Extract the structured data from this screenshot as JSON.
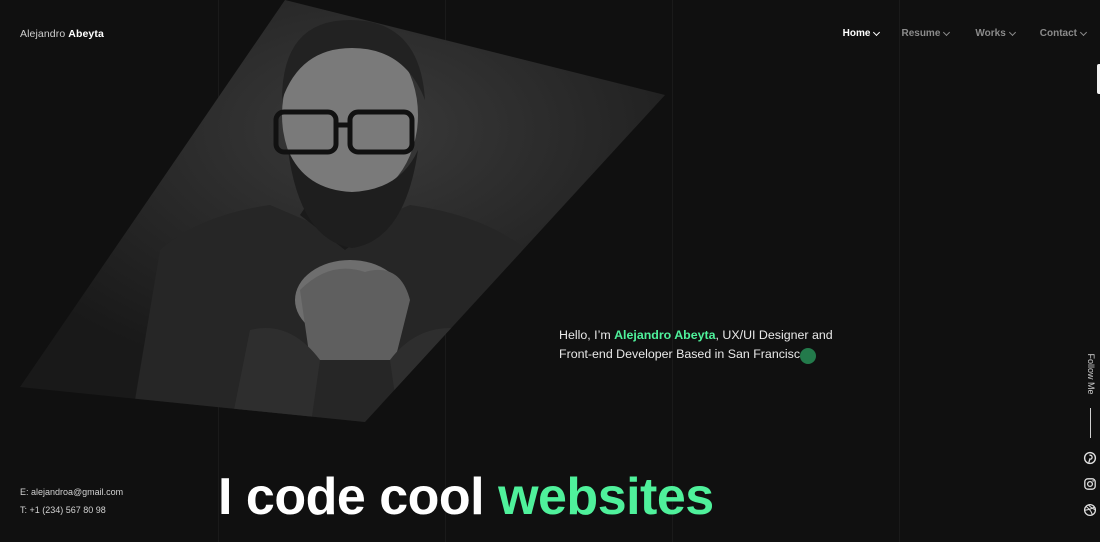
{
  "brand": {
    "first_name": "Alejandro",
    "last_name": "Abeyta"
  },
  "nav": {
    "items": [
      {
        "label": "Home",
        "active": true
      },
      {
        "label": "Resume",
        "active": false
      },
      {
        "label": "Works",
        "active": false
      },
      {
        "label": "Contact",
        "active": false
      }
    ]
  },
  "hero": {
    "intro_prefix": "Hello, I’m ",
    "intro_name": "Alejandro Abeyta",
    "intro_suffix": ", UX/UI Designer and Front-end Developer Based in San Francisco.",
    "headline_main": "I code cool ",
    "headline_accent": "websites"
  },
  "sidebar": {
    "follow_label": "Follow Me",
    "socials": [
      "pinterest-icon",
      "instagram-icon",
      "dribbble-icon"
    ]
  },
  "contact": {
    "email": "E: alejandroa@gmail.com",
    "phone": "T: +1 (234) 567 80 98"
  },
  "colors": {
    "accent": "#4ff19b",
    "background": "#101010",
    "dot": "#237a4b"
  }
}
